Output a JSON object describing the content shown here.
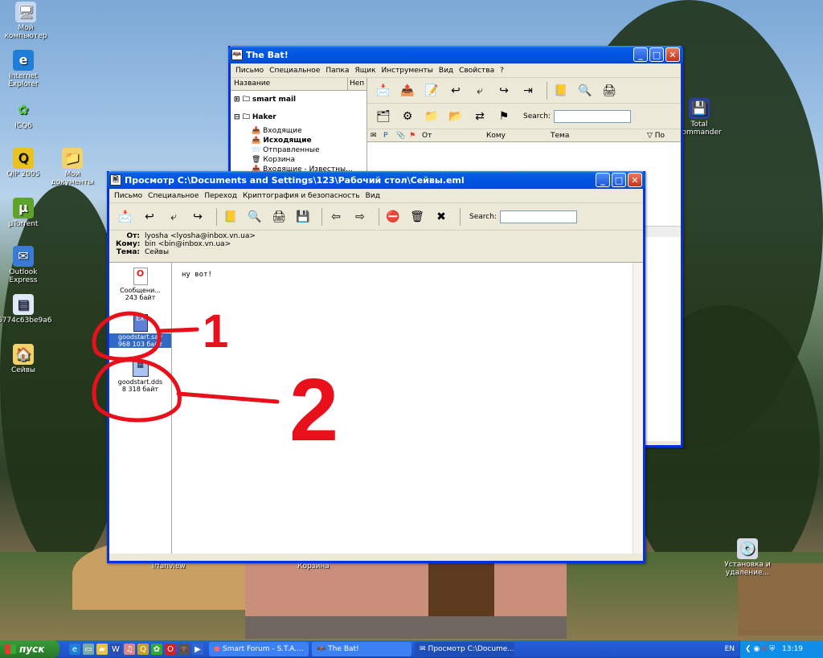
{
  "desktop_icons": [
    {
      "label": "Мой компьютер",
      "icon": "computer-icon"
    },
    {
      "label": "Internet Explorer",
      "icon": "ie-icon"
    },
    {
      "label": "ICQ6",
      "icon": "icq-flower-icon"
    },
    {
      "label": "QIP 2005",
      "icon": "qip-icon"
    },
    {
      "label": "Мои документы",
      "icon": "folder-icon"
    },
    {
      "label": "µTorrent",
      "icon": "utorrent-icon"
    },
    {
      "label": "Outlook Express",
      "icon": "outlook-icon"
    },
    {
      "label": "6774c63be9a6",
      "icon": "file-icon"
    },
    {
      "label": "Сейвы",
      "icon": "folder-icon"
    },
    {
      "label": "Total Commander",
      "icon": "floppy-icon"
    },
    {
      "label": "Установка и удаление...",
      "icon": "cd-icon"
    },
    {
      "label": "Irfanview",
      "icon": "irfanview-icon"
    },
    {
      "label": "Корзина",
      "icon": "recycle-bin-icon"
    }
  ],
  "bat_window": {
    "title": "The Bat!",
    "menu": [
      "Письмо",
      "Специальное",
      "Папка",
      "Ящик",
      "Инструменты",
      "Вид",
      "Свойства",
      "?"
    ],
    "folder_header": "Название",
    "folder_header_2": "Неп",
    "accounts": [
      {
        "name": "smart mail",
        "expanded": false
      },
      {
        "name": "Haker",
        "expanded": true
      }
    ],
    "folders": [
      "Входящие",
      "Исходящие",
      "Отправленные",
      "Корзина",
      "Входящие - Известны..."
    ],
    "search_label": "Search:",
    "columns": [
      "От",
      "Кому",
      "Тема",
      "▽ По"
    ]
  },
  "viewer_window": {
    "title": "Просмотр C:\\Documents and Settings\\123\\Рабочий стол\\Сейвы.eml",
    "menu": [
      "Письмо",
      "Специальное",
      "Переход",
      "Криптография и безопасность",
      "Вид"
    ],
    "search_label": "Search:",
    "headers": [
      {
        "label": "От:",
        "value": "lyosha <lyosha@inbox.vn.ua>"
      },
      {
        "label": "Кому:",
        "value": "bin <bin@inbox.vn.ua>"
      },
      {
        "label": "Тема:",
        "value": "Сейвы"
      }
    ],
    "attachments": [
      {
        "name": "Сообщени...",
        "size": "243 байт",
        "icon": "message-attachment-icon",
        "selected": false
      },
      {
        "name": "goodstart.sav",
        "size": "968 103 байт",
        "icon": "sav-file-icon",
        "selected": true
      },
      {
        "name": "goodstart.dds",
        "size": "8 318 байт",
        "icon": "dds-file-icon",
        "selected": false
      }
    ],
    "body_text": "ну вот!"
  },
  "annotations": {
    "label_1": "1",
    "label_2": "2",
    "color": "#e8101a"
  },
  "taskbar": {
    "start_label": "пуск",
    "buttons": [
      {
        "label": "Smart Forum - S.T.A....",
        "active": false
      },
      {
        "label": "The Bat!",
        "active": false
      },
      {
        "label": "Просмотр C:\\Docume...",
        "active": true
      }
    ],
    "language": "EN",
    "clock": "13:19"
  }
}
